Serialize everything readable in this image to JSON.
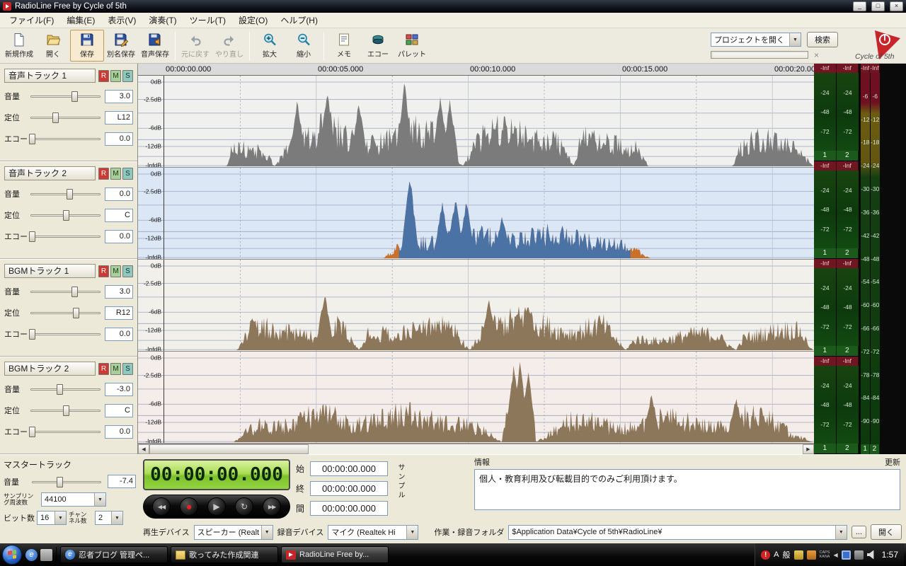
{
  "titlebar": {
    "title": "RadioLine Free by Cycle of 5th",
    "minimize": "_",
    "maximize": "□",
    "close": "×"
  },
  "menubar": {
    "items": [
      "ファイル(F)",
      "編集(E)",
      "表示(V)",
      "演奏(T)",
      "ツール(T)",
      "設定(O)",
      "ヘルプ(H)"
    ]
  },
  "toolbar": {
    "buttons": [
      {
        "label": "新規作成",
        "icon": "new-file-icon",
        "state": "normal",
        "group_end": false
      },
      {
        "label": "開く",
        "icon": "open-folder-icon",
        "state": "normal",
        "group_end": false
      },
      {
        "label": "保存",
        "icon": "save-icon",
        "state": "active",
        "group_end": false
      },
      {
        "label": "別名保存",
        "icon": "save-as-icon",
        "state": "normal",
        "group_end": false
      },
      {
        "label": "音声保存",
        "icon": "save-audio-icon",
        "state": "normal",
        "group_end": true
      },
      {
        "label": "元に戻す",
        "icon": "undo-icon",
        "state": "disabled",
        "group_end": false
      },
      {
        "label": "やり直し",
        "icon": "redo-icon",
        "state": "disabled",
        "group_end": true
      },
      {
        "label": "拡大",
        "icon": "zoom-in-icon",
        "state": "normal",
        "group_end": false
      },
      {
        "label": "縮小",
        "icon": "zoom-out-icon",
        "state": "normal",
        "group_end": true
      },
      {
        "label": "メモ",
        "icon": "memo-icon",
        "state": "normal",
        "group_end": false
      },
      {
        "label": "エコー",
        "icon": "echo-icon",
        "state": "normal",
        "group_end": false
      },
      {
        "label": "パレット",
        "icon": "palette-icon",
        "state": "normal",
        "group_end": false
      }
    ],
    "project_combo": "プロジェクトを開く",
    "search_label": "検索",
    "logo_text": "Cycle of 5th"
  },
  "track_labels": {
    "volume": "音量",
    "pan": "定位",
    "echo": "エコー",
    "r": "R",
    "m": "M",
    "s": "S"
  },
  "tracks": [
    {
      "name": "音声トラック 1",
      "volume": "3.0",
      "vol_pos": 0.62,
      "pan": "L12",
      "pan_pos": 0.36,
      "echo": "0.0",
      "echo_pos": 0.03
    },
    {
      "name": "音声トラック 2",
      "volume": "0.0",
      "vol_pos": 0.55,
      "pan": "C",
      "pan_pos": 0.5,
      "echo": "0.0",
      "echo_pos": 0.03
    },
    {
      "name": "BGMトラック 1",
      "volume": "3.0",
      "vol_pos": 0.62,
      "pan": "R12",
      "pan_pos": 0.64,
      "echo": "0.0",
      "echo_pos": 0.03
    },
    {
      "name": "BGMトラック 2",
      "volume": "-3.0",
      "vol_pos": 0.42,
      "pan": "C",
      "pan_pos": 0.5,
      "echo": "0.0",
      "echo_pos": 0.03
    }
  ],
  "master": {
    "title": "マスタートラック",
    "volume_label": "音量",
    "volume": "-7.4",
    "vol_pos": 0.4,
    "sampling_label_1": "サンプリン",
    "sampling_label_2": "グ周波数",
    "sampling": "44100",
    "bits_label": "ビット数",
    "bits": "16",
    "channels_label_1": "チャン",
    "channels_label_2": "ネル数",
    "channels": "2"
  },
  "timeline": {
    "ticks": [
      "00:00:00.000",
      "00:00:05.000",
      "00:00:10.000",
      "00:00:15.000",
      "00:00:20.000"
    ]
  },
  "waveview": {
    "db_rows": [
      {
        "label": "0dB",
        "y": 0.07
      },
      {
        "label": "-2.5dB",
        "y": 0.26
      },
      {
        "label": "",
        "y": 0.41
      },
      {
        "label": "-6dB",
        "y": 0.575
      },
      {
        "label": "",
        "y": 0.7
      },
      {
        "label": "-12dB",
        "y": 0.775
      },
      {
        "label": "",
        "y": 0.885
      },
      {
        "label": "-InfdB",
        "y": 0.985
      }
    ],
    "lanes": [
      {
        "bg": "#f0f0ee",
        "color": "#7b7b7b",
        "segments": [
          [
            0.096,
            0.17,
            0.28
          ],
          [
            0.17,
            0.46,
            0.68
          ],
          [
            0.46,
            0.63,
            0.58
          ],
          [
            0.63,
            0.745,
            0.45
          ],
          [
            0.875,
            0.998,
            0.5
          ]
        ],
        "spikes": [
          [
            0.205,
            0.82
          ],
          [
            0.251,
            0.97
          ],
          [
            0.3,
            0.8
          ],
          [
            0.37,
            1.0
          ],
          [
            0.425,
            0.85
          ],
          [
            0.44,
            0.8
          ]
        ]
      },
      {
        "bg": "#dce7f5",
        "color": "#4a72a4",
        "edge_color": "#c9702b",
        "edges": [
          [
            0.338,
            0.36
          ],
          [
            0.718,
            0.748
          ]
        ],
        "segments": [
          [
            0.338,
            0.748,
            0.4
          ]
        ],
        "spikes": [
          [
            0.378,
            1.0
          ],
          [
            0.428,
            0.66
          ],
          [
            0.448,
            0.72
          ],
          [
            0.465,
            0.68
          ],
          [
            0.52,
            0.5
          ]
        ]
      },
      {
        "bg": "#f2f0ea",
        "color": "#8d775b",
        "segments": [
          [
            0.112,
            0.3,
            0.45
          ],
          [
            0.3,
            0.47,
            0.4
          ],
          [
            0.47,
            0.71,
            0.52
          ],
          [
            0.71,
            0.88,
            0.3
          ],
          [
            0.88,
            0.998,
            0.33
          ]
        ],
        "spikes": [
          [
            0.247,
            0.72
          ],
          [
            0.5,
            0.6
          ],
          [
            0.56,
            0.58
          ]
        ]
      },
      {
        "bg": "#f4ede9",
        "color": "#8d775b",
        "segments": [
          [
            0.107,
            0.52,
            0.44
          ],
          [
            0.52,
            0.57,
            0.6
          ],
          [
            0.57,
            0.998,
            0.42
          ]
        ],
        "spikes": [
          [
            0.538,
            0.93
          ],
          [
            0.548,
            0.97
          ],
          [
            0.56,
            0.85
          ],
          [
            0.75,
            0.6
          ],
          [
            0.88,
            0.55
          ]
        ]
      }
    ]
  },
  "meters": {
    "track_header": [
      "-Inf",
      "-Inf"
    ],
    "track_scale": [
      "-24",
      "-48",
      "-72"
    ],
    "channels": [
      "1",
      "2"
    ],
    "master_header": [
      "-Inf",
      "-Inf"
    ],
    "master_scale": [
      "-6",
      "-12",
      "-18",
      "-24",
      "-30",
      "-36",
      "-42",
      "-48",
      "-54",
      "-60",
      "-66",
      "-72",
      "-78",
      "-84",
      "-90"
    ]
  },
  "transport": {
    "time": "00:00:00.000",
    "buttons": [
      {
        "name": "prev-button",
        "glyph": "◀◀"
      },
      {
        "name": "record-button",
        "glyph": "●"
      },
      {
        "name": "play-button",
        "glyph": "▶"
      },
      {
        "name": "loop-button",
        "glyph": "↻"
      },
      {
        "name": "next-button",
        "glyph": "▶▶"
      }
    ]
  },
  "region": {
    "start_label": "始",
    "end_label": "終",
    "span_label": "間",
    "start": "00:00:00.000",
    "end": "00:00:00.000",
    "span": "00:00:00.000",
    "sample_label": "サンプル"
  },
  "info": {
    "title": "情報",
    "update_label": "更新",
    "message": "個人・教育利用及び転載目的でのみご利用頂けます。"
  },
  "devices": {
    "playback_label": "再生デバイス",
    "playback_value": "スピーカー (Realt",
    "record_label": "録音デバイス",
    "record_value": "マイク (Realtek Hi",
    "folder_label": "作業・録音フォルダ",
    "folder_value": "$Application Data¥Cycle of 5th¥RadioLine¥",
    "more_label": "...",
    "open_label": "開く"
  },
  "taskbar": {
    "tasks": [
      {
        "label": "忍者ブログ 管理ペ...",
        "icon": "ie-icon",
        "active": false
      },
      {
        "label": "歌ってみた作成関連",
        "icon": "folder-icon",
        "active": false
      },
      {
        "label": "RadioLine Free by...",
        "icon": "radioline-icon",
        "active": true
      }
    ],
    "ime_a": "A",
    "ime_gen": "般",
    "caps": "CAPS",
    "kana": "KANA",
    "time": "1:57"
  }
}
